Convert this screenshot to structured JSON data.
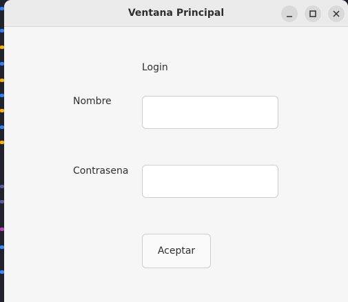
{
  "window": {
    "title": "Ventana Principal",
    "controls": [
      "minimize-icon",
      "maximize-icon",
      "close-icon"
    ]
  },
  "form": {
    "heading": "Login",
    "nombre_label": "Nombre",
    "nombre_value": "",
    "password_label": "Contrasena",
    "password_value": "",
    "submit_label": "Aceptar"
  },
  "colors": {
    "window_bg": "#f6f6f6",
    "titlebar_bg": "#ebebeb",
    "control_bg": "#d9d9d9",
    "text": "#2e2e2e",
    "field_border": "#cdcdcd"
  }
}
